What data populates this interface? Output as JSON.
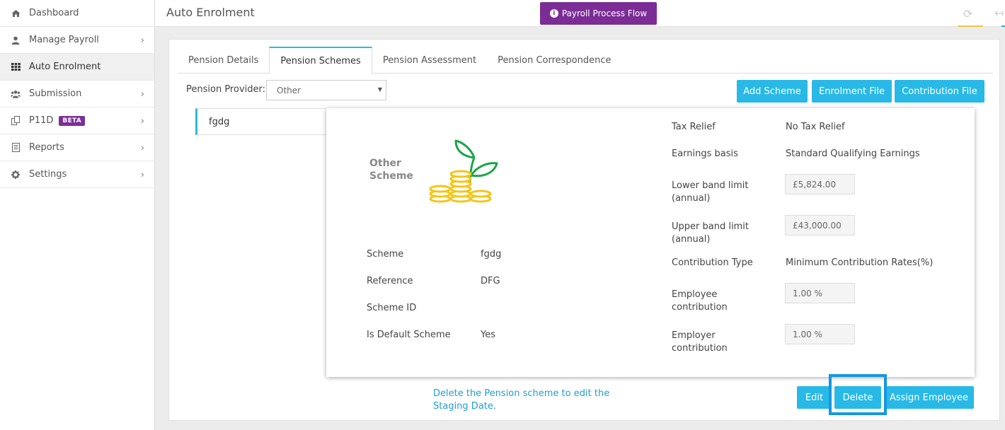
{
  "sidebar": {
    "items": [
      {
        "label": "Dashboard",
        "icon": "home-icon",
        "chevron": false,
        "active": false
      },
      {
        "label": "Manage Payroll",
        "icon": "user-icon",
        "chevron": true,
        "active": false
      },
      {
        "label": "Auto Enrolment",
        "icon": "grid-icon",
        "chevron": false,
        "active": true
      },
      {
        "label": "Submission",
        "icon": "users-icon",
        "chevron": true,
        "active": false
      },
      {
        "label": "P11D",
        "icon": "copy-icon",
        "chevron": true,
        "active": false,
        "badge": "BETA"
      },
      {
        "label": "Reports",
        "icon": "document-icon",
        "chevron": true,
        "active": false
      },
      {
        "label": "Settings",
        "icon": "gear-icon",
        "chevron": true,
        "active": false
      }
    ]
  },
  "header": {
    "title": "Auto Enrolment",
    "flow_button": "Payroll Process Flow"
  },
  "tabs": [
    {
      "label": "Pension Details",
      "active": false
    },
    {
      "label": "Pension Schemes",
      "active": true
    },
    {
      "label": "Pension Assessment",
      "active": false
    },
    {
      "label": "Pension Correspondence",
      "active": false
    }
  ],
  "provider": {
    "label": "Pension Provider:",
    "selected": "Other"
  },
  "actions": {
    "add_scheme": "Add Scheme",
    "enrolment_file": "Enrolment File",
    "contribution_file": "Contribution File"
  },
  "scheme_list": [
    "fgdg"
  ],
  "card": {
    "logo_text": "Other Scheme",
    "left": [
      {
        "label": "Scheme",
        "value": "fgdg"
      },
      {
        "label": "Reference",
        "value": "DFG"
      },
      {
        "label": "Scheme ID",
        "value": ""
      },
      {
        "label": "Is Default Scheme",
        "value": "Yes"
      }
    ],
    "tax_relief": {
      "label": "Tax Relief",
      "value": "No Tax Relief"
    },
    "earnings_basis": {
      "label": "Earnings basis",
      "value": "Standard Qualifying Earnings"
    },
    "lower_band": {
      "label": "Lower band limit (annual)",
      "value": "£5,824.00"
    },
    "upper_band": {
      "label": "Upper band limit (annual)",
      "value": "£43,000.00"
    },
    "contribution_type": {
      "label": "Contribution Type",
      "value": "Minimum Contribution Rates(%)"
    },
    "employee_contribution": {
      "label": "Employee contribution",
      "value": "1.00 %"
    },
    "employer_contribution": {
      "label": "Employer contribution",
      "value": "1.00 %"
    }
  },
  "footer": {
    "hint": "Delete the Pension scheme to edit the Staging Date.",
    "edit": "Edit",
    "delete": "Delete",
    "assign": "Assign Employee"
  },
  "colors": {
    "accent": "#29b9e6",
    "purple": "#7b2d95",
    "coin": "#f5c518",
    "leaf": "#1aa64a",
    "highlight": "#1597e2"
  }
}
